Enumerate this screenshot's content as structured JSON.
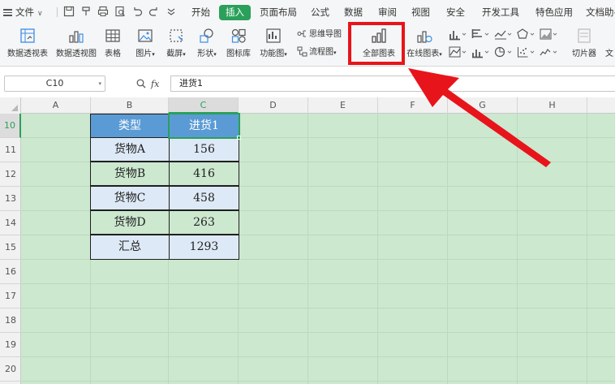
{
  "menubar": {
    "file_label": "文件",
    "tabs": [
      "开始",
      "插入",
      "页面布局",
      "公式",
      "数据",
      "审阅",
      "视图",
      "安全",
      "开发工具",
      "特色应用",
      "文档助手"
    ],
    "active_tab": "插入"
  },
  "ribbon": {
    "pivot_table": "数据透视表",
    "pivot_chart": "数据透视图",
    "table": "表格",
    "picture": "图片",
    "screenshot": "截屏",
    "shape": "形状",
    "icon_library": "图标库",
    "function_chart": "功能图",
    "mind_map": "思维导图",
    "flowchart": "流程图",
    "all_charts": "全部图表",
    "online_chart": "在线图表",
    "slicer": "切片器",
    "text_partial": "文"
  },
  "formula_bar": {
    "name_box": "C10",
    "fx_label": "fx",
    "content": "进货1"
  },
  "sheet": {
    "columns": [
      "A",
      "B",
      "C",
      "D",
      "E",
      "F",
      "G",
      "H"
    ],
    "rows": [
      "10",
      "11",
      "12",
      "13",
      "14",
      "15",
      "16",
      "17",
      "18",
      "19",
      "20"
    ],
    "selected_column": "C",
    "selected_row": "10",
    "table": {
      "header": [
        "类型",
        "进货1"
      ],
      "rows": [
        [
          "货物A",
          "156"
        ],
        [
          "货物B",
          "416"
        ],
        [
          "货物C",
          "458"
        ],
        [
          "货物D",
          "263"
        ],
        [
          "汇总",
          "1293"
        ]
      ]
    }
  },
  "colors": {
    "accent_green": "#2aa05a",
    "highlight_red": "#e8141b",
    "sheet_bg": "#cce8cf",
    "header_blue": "#5b9bd5"
  }
}
